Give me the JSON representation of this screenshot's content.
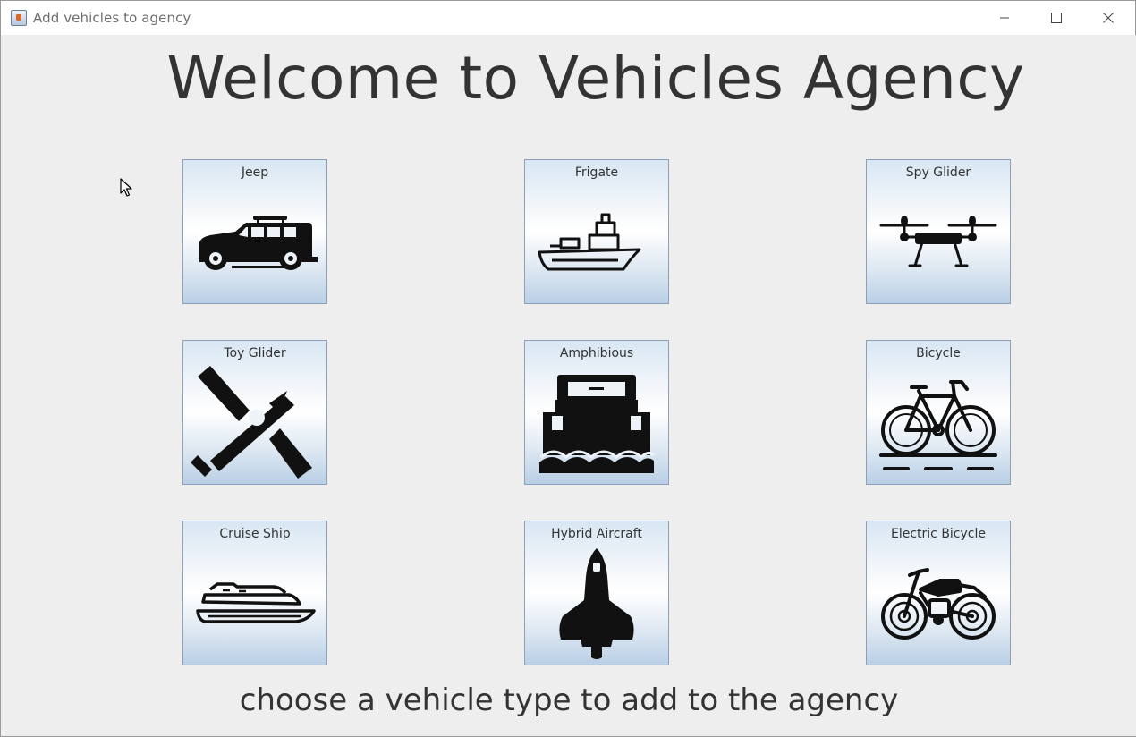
{
  "window": {
    "title": "Add vehicles to agency",
    "controls": [
      "minimize-icon",
      "maximize-icon",
      "close-icon"
    ]
  },
  "main": {
    "headline": "Welcome to Vehicles Agency",
    "footer": "choose a vehicle type to add to the agency"
  },
  "vehicles": [
    {
      "label": "Jeep",
      "icon": "jeep-icon"
    },
    {
      "label": "Frigate",
      "icon": "frigate-icon"
    },
    {
      "label": "Spy Glider",
      "icon": "drone-icon"
    },
    {
      "label": "Toy Glider",
      "icon": "toy-glider-icon"
    },
    {
      "label": "Amphibious",
      "icon": "amphibious-icon"
    },
    {
      "label": "Bicycle",
      "icon": "bicycle-icon"
    },
    {
      "label": "Cruise Ship",
      "icon": "cruise-ship-icon"
    },
    {
      "label": "Hybrid Aircraft",
      "icon": "space-shuttle-icon"
    },
    {
      "label": "Electric Bicycle",
      "icon": "motorbike-icon"
    }
  ],
  "colors": {
    "text": "#333333",
    "button_border": "#8ea0b8",
    "button_gradient_bottom": "#b9cfe5"
  }
}
